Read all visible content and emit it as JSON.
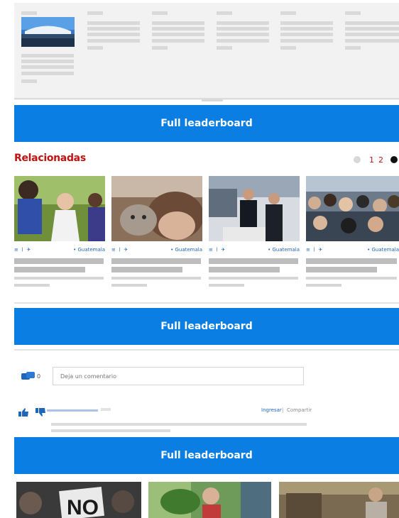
{
  "top_strip": {
    "image_icon": "stadium-photo-icon"
  },
  "leaderboard": {
    "label1": "Full leaderboard",
    "label2": "Full leaderboard",
    "label3": "Full leaderboard"
  },
  "related": {
    "title": "Relacionadas",
    "pager": {
      "page1": "1",
      "page2": "2"
    },
    "cards": [
      {
        "image_icon": "children-playing-photo-icon",
        "tag": "Guatemala"
      },
      {
        "image_icon": "kitten-photo-icon",
        "tag": "Guatemala"
      },
      {
        "image_icon": "business-people-photo-icon",
        "tag": "Guatemala"
      },
      {
        "image_icon": "crowd-photo-icon",
        "tag": "Guatemala"
      }
    ]
  },
  "comments": {
    "count": "0",
    "placeholder": "Deja un comentario",
    "signin": "Ingresar",
    "divider": "|",
    "share": "Compartir"
  },
  "bottom_photos": [
    {
      "image_icon": "protest-sign-no-photo-icon",
      "text": "NO"
    },
    {
      "image_icon": "woman-with-plant-photo-icon"
    },
    {
      "image_icon": "woman-sitting-photo-icon"
    }
  ],
  "colors": {
    "leaderboard_blue": "#0a7ee3",
    "related_red": "#c41111",
    "link_blue": "#1f65b8"
  }
}
